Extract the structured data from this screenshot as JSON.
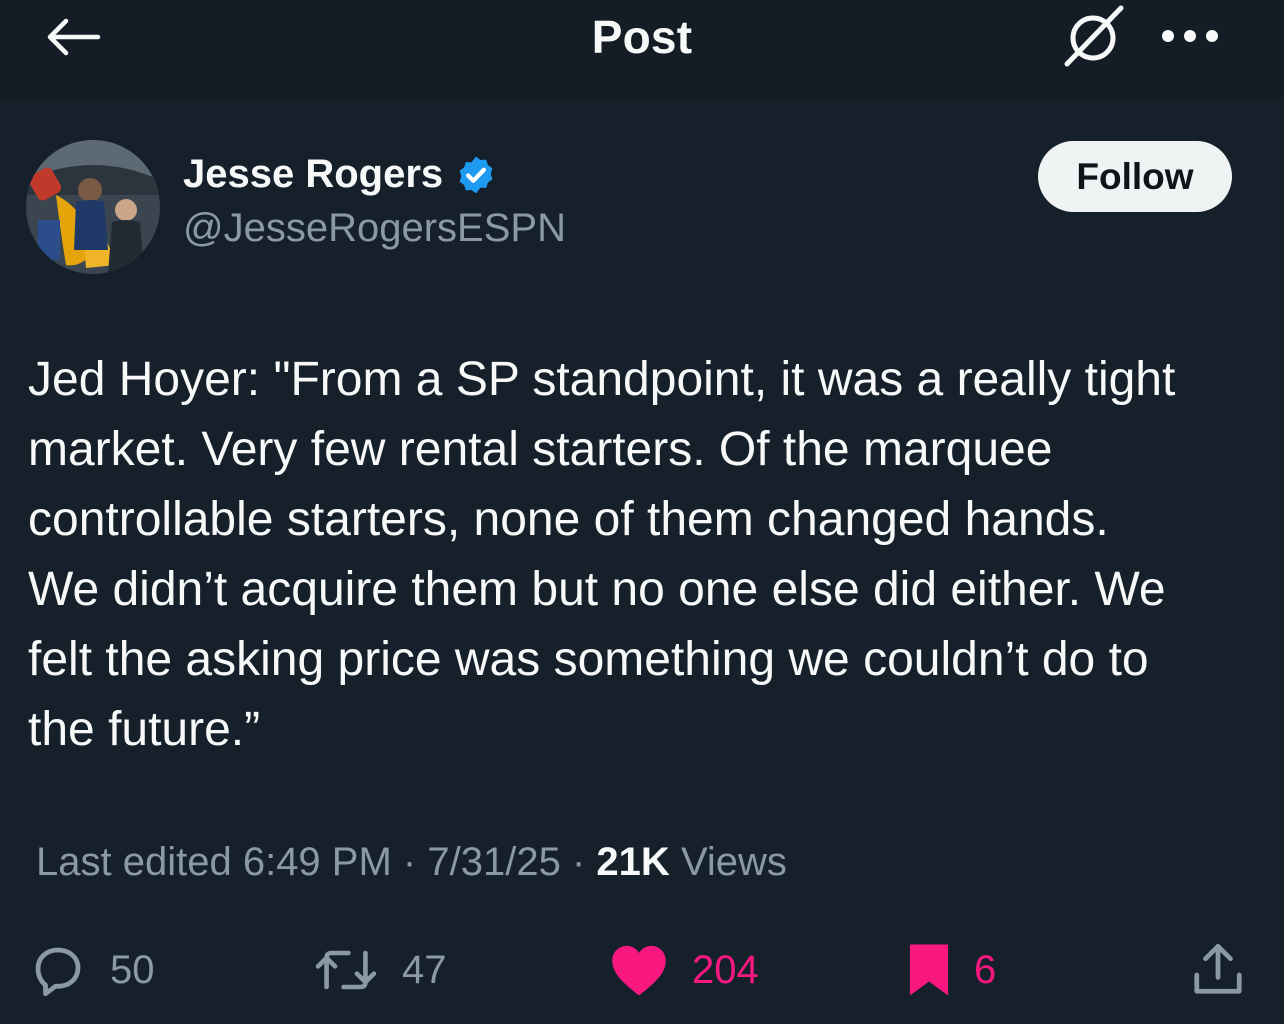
{
  "header": {
    "title": "Post",
    "back_icon": "arrow-left-icon",
    "grok_icon": "grok-icon",
    "more_icon": "more-horizontal-icon"
  },
  "author": {
    "name": "Jesse Rogers",
    "handle": "@JesseRogersESPN",
    "verified": true,
    "verified_color": "#1d9bf0"
  },
  "follow_label": "Follow",
  "tweet": {
    "text": "Jed Hoyer: \"From a SP standpoint, it was a really tight\nmarket. Very few rental starters. Of the marquee\ncontrollable starters, none of them changed hands.\nWe didn’t acquire them but no one else did either.  We\nfelt the asking price was something we couldn’t do to\nthe future.”"
  },
  "meta": {
    "edited_prefix": "Last edited",
    "time": "6:49 PM",
    "date": "7/31/25",
    "views_count": "21K",
    "views_label": "Views"
  },
  "actions": {
    "replies": "50",
    "reposts": "47",
    "likes": "204",
    "bookmarks": "6"
  },
  "colors": {
    "background": "#15202b",
    "text_primary": "#f7f9f9",
    "text_secondary": "#8b98a5",
    "like_active": "#f91880"
  }
}
